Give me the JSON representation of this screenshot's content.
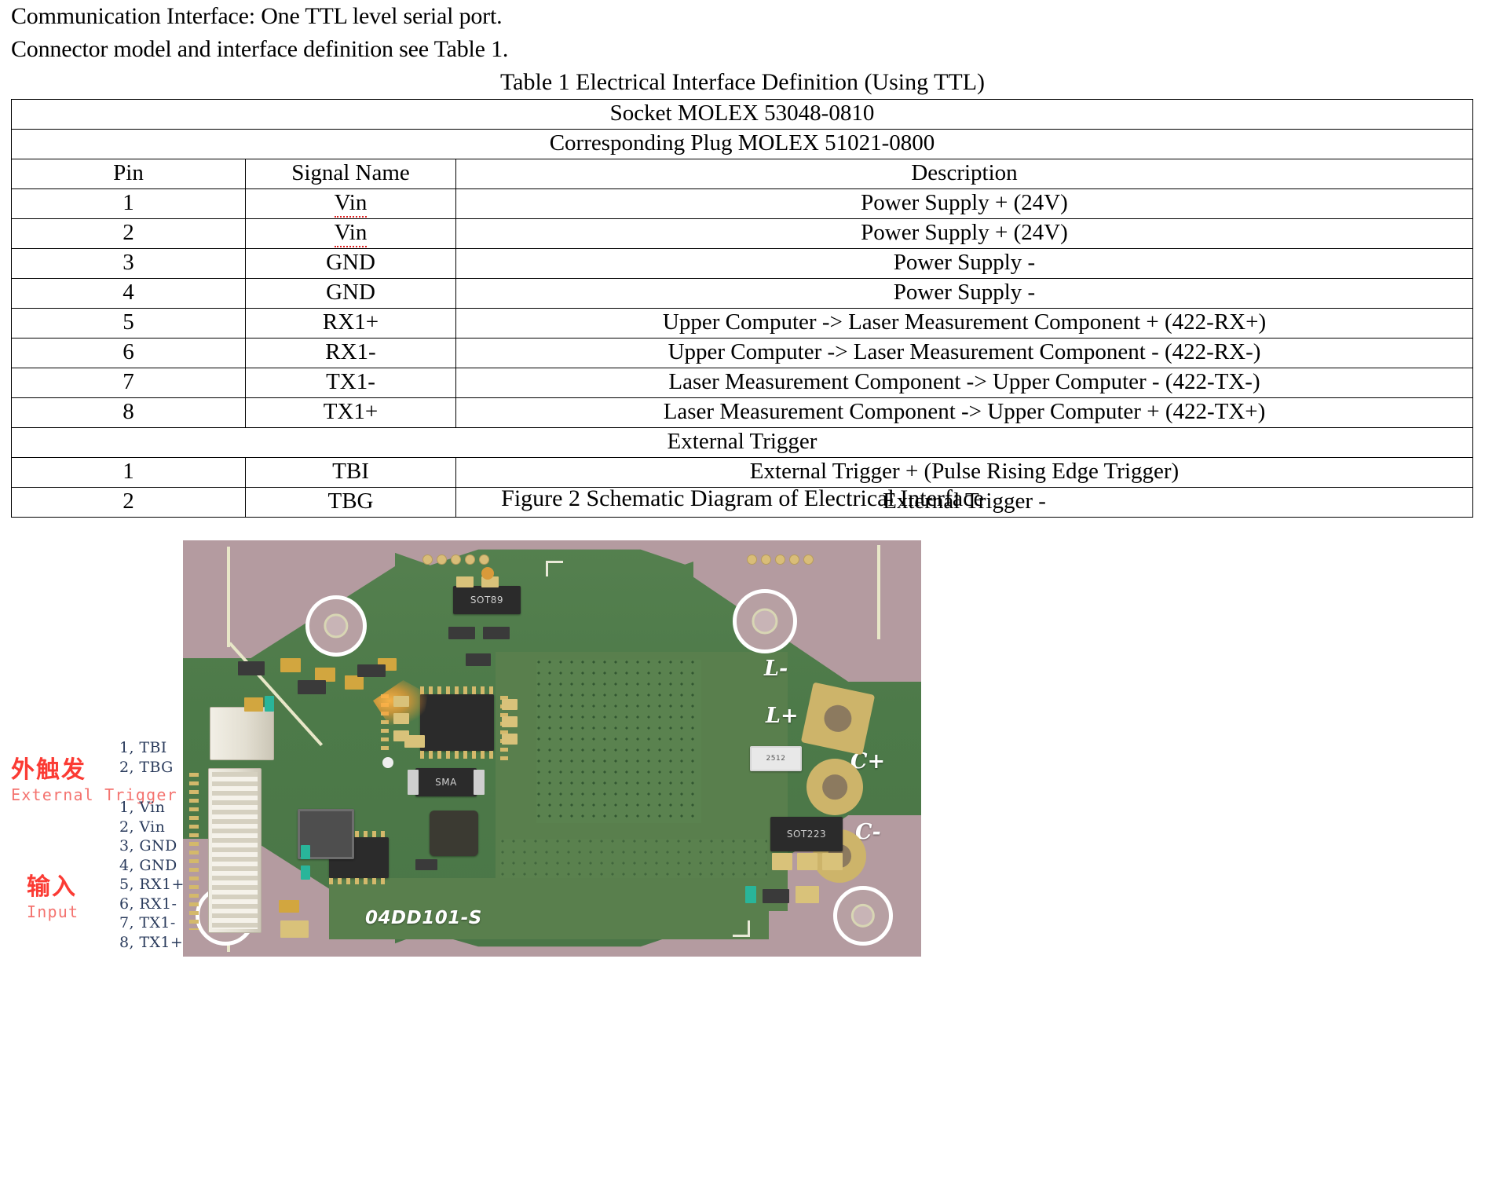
{
  "document": {
    "intro_line_1": "Communication Interface: One TTL level serial port.",
    "intro_line_2": "Connector model and interface definition see Table 1.",
    "table_caption": "Table 1 Electrical Interface Definition (Using TTL)",
    "figure_caption": "Figure 2 Schematic Diagram of Electrical Interface"
  },
  "table": {
    "socket_row": "Socket MOLEX 53048-0810",
    "plug_row": "Corresponding Plug MOLEX 51021-0800",
    "headers": {
      "pin": "Pin",
      "signal": "Signal Name",
      "description": "Description"
    },
    "section_row": "External Trigger",
    "rows": [
      {
        "pin": "1",
        "signal": "Vin",
        "signal_flagged": true,
        "description": "Power Supply + (24V)"
      },
      {
        "pin": "2",
        "signal": "Vin",
        "signal_flagged": true,
        "description": "Power Supply + (24V)"
      },
      {
        "pin": "3",
        "signal": "GND",
        "signal_flagged": false,
        "description": "Power Supply -"
      },
      {
        "pin": "4",
        "signal": "GND",
        "signal_flagged": false,
        "description": "Power Supply -"
      },
      {
        "pin": "5",
        "signal": "RX1+",
        "signal_flagged": false,
        "description": "Upper Computer -> Laser Measurement Component + (422-RX+)"
      },
      {
        "pin": "6",
        "signal": "RX1-",
        "signal_flagged": false,
        "description": "Upper Computer -> Laser Measurement Component - (422-RX-)"
      },
      {
        "pin": "7",
        "signal": "TX1-",
        "signal_flagged": false,
        "description": "Laser Measurement Component -> Upper Computer - (422-TX-)"
      },
      {
        "pin": "8",
        "signal": "TX1+",
        "signal_flagged": false,
        "description": "Laser Measurement Component -> Upper Computer + (422-TX+)"
      }
    ],
    "trigger_rows": [
      {
        "pin": "1",
        "signal": "TBI",
        "description": "External Trigger + (Pulse Rising Edge Trigger)"
      },
      {
        "pin": "2",
        "signal": "TBG",
        "description": "External Trigger -"
      }
    ]
  },
  "annotations": {
    "external_trigger": {
      "label_cn": "外触发",
      "label_en": "External Trigger",
      "pins": "1, TBI\n2, TBG"
    },
    "input": {
      "label_cn": "输入",
      "label_en": "Input",
      "pins": "1, Vin\n2, Vin\n3, GND\n4, GND\n5, RX1+\n6, RX1-\n7, TX1-\n8, TX1+"
    },
    "colors": {
      "chinese_label": "#fb3b34",
      "english_label": "#f4736f",
      "pin_text": "#2a3b5c"
    }
  },
  "pcb": {
    "board_code": "04DD101-S",
    "silk_labels": {
      "l_minus": "L-",
      "l_plus": "L+",
      "c_plus": "C+",
      "c_minus": "C-"
    },
    "component_marks": {
      "sot89": "SOT89",
      "sot223": "SOT223",
      "sma": "SMA",
      "cap2512": "2512"
    },
    "colors": {
      "solder_mask": "#4d7a49",
      "substrate": "#b49ba0",
      "silkscreen": "#ffffff",
      "pad_gold": "#d9c27a"
    }
  }
}
